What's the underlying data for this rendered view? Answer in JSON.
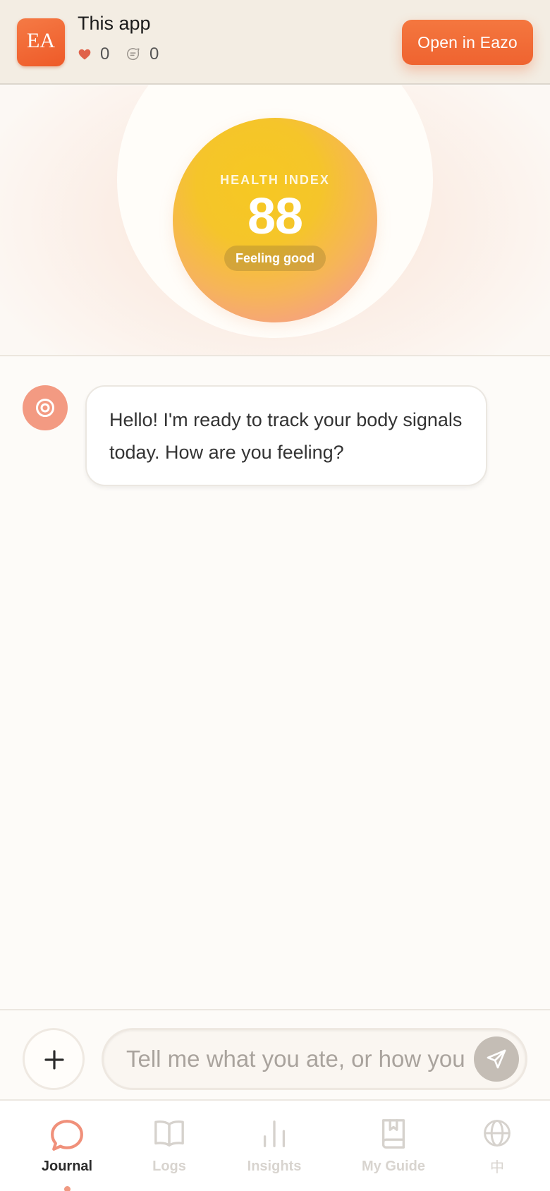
{
  "banner": {
    "logo_text": "EA",
    "app_name": "This app",
    "likes": "0",
    "comments": "0",
    "open_button": "Open in Eazo"
  },
  "hero": {
    "label": "HEALTH INDEX",
    "value": "88",
    "status": "Feeling good"
  },
  "chat": {
    "messages": [
      {
        "sender": "bot",
        "text": "Hello! I'm ready to track your body signals today. How are you feeling?"
      }
    ]
  },
  "composer": {
    "placeholder": "Tell me what you ate, or how you feel",
    "value": ""
  },
  "nav": {
    "items": [
      {
        "label": "Journal",
        "icon": "chat-bubble-icon",
        "active": true
      },
      {
        "label": "Logs",
        "icon": "book-icon",
        "active": false
      },
      {
        "label": "Insights",
        "icon": "bar-chart-icon",
        "active": false
      },
      {
        "label": "My Guide",
        "icon": "bookmark-book-icon",
        "active": false
      },
      {
        "label": "中",
        "icon": "globe-icon",
        "active": false
      }
    ]
  },
  "colors": {
    "accent": "#ef6330",
    "orb_yellow": "#f6c822",
    "orb_pink": "#f59c92",
    "avatar": "#f39a82",
    "nav_active_text": "#2b2b2b",
    "nav_inactive_text": "#d8d4cf"
  }
}
